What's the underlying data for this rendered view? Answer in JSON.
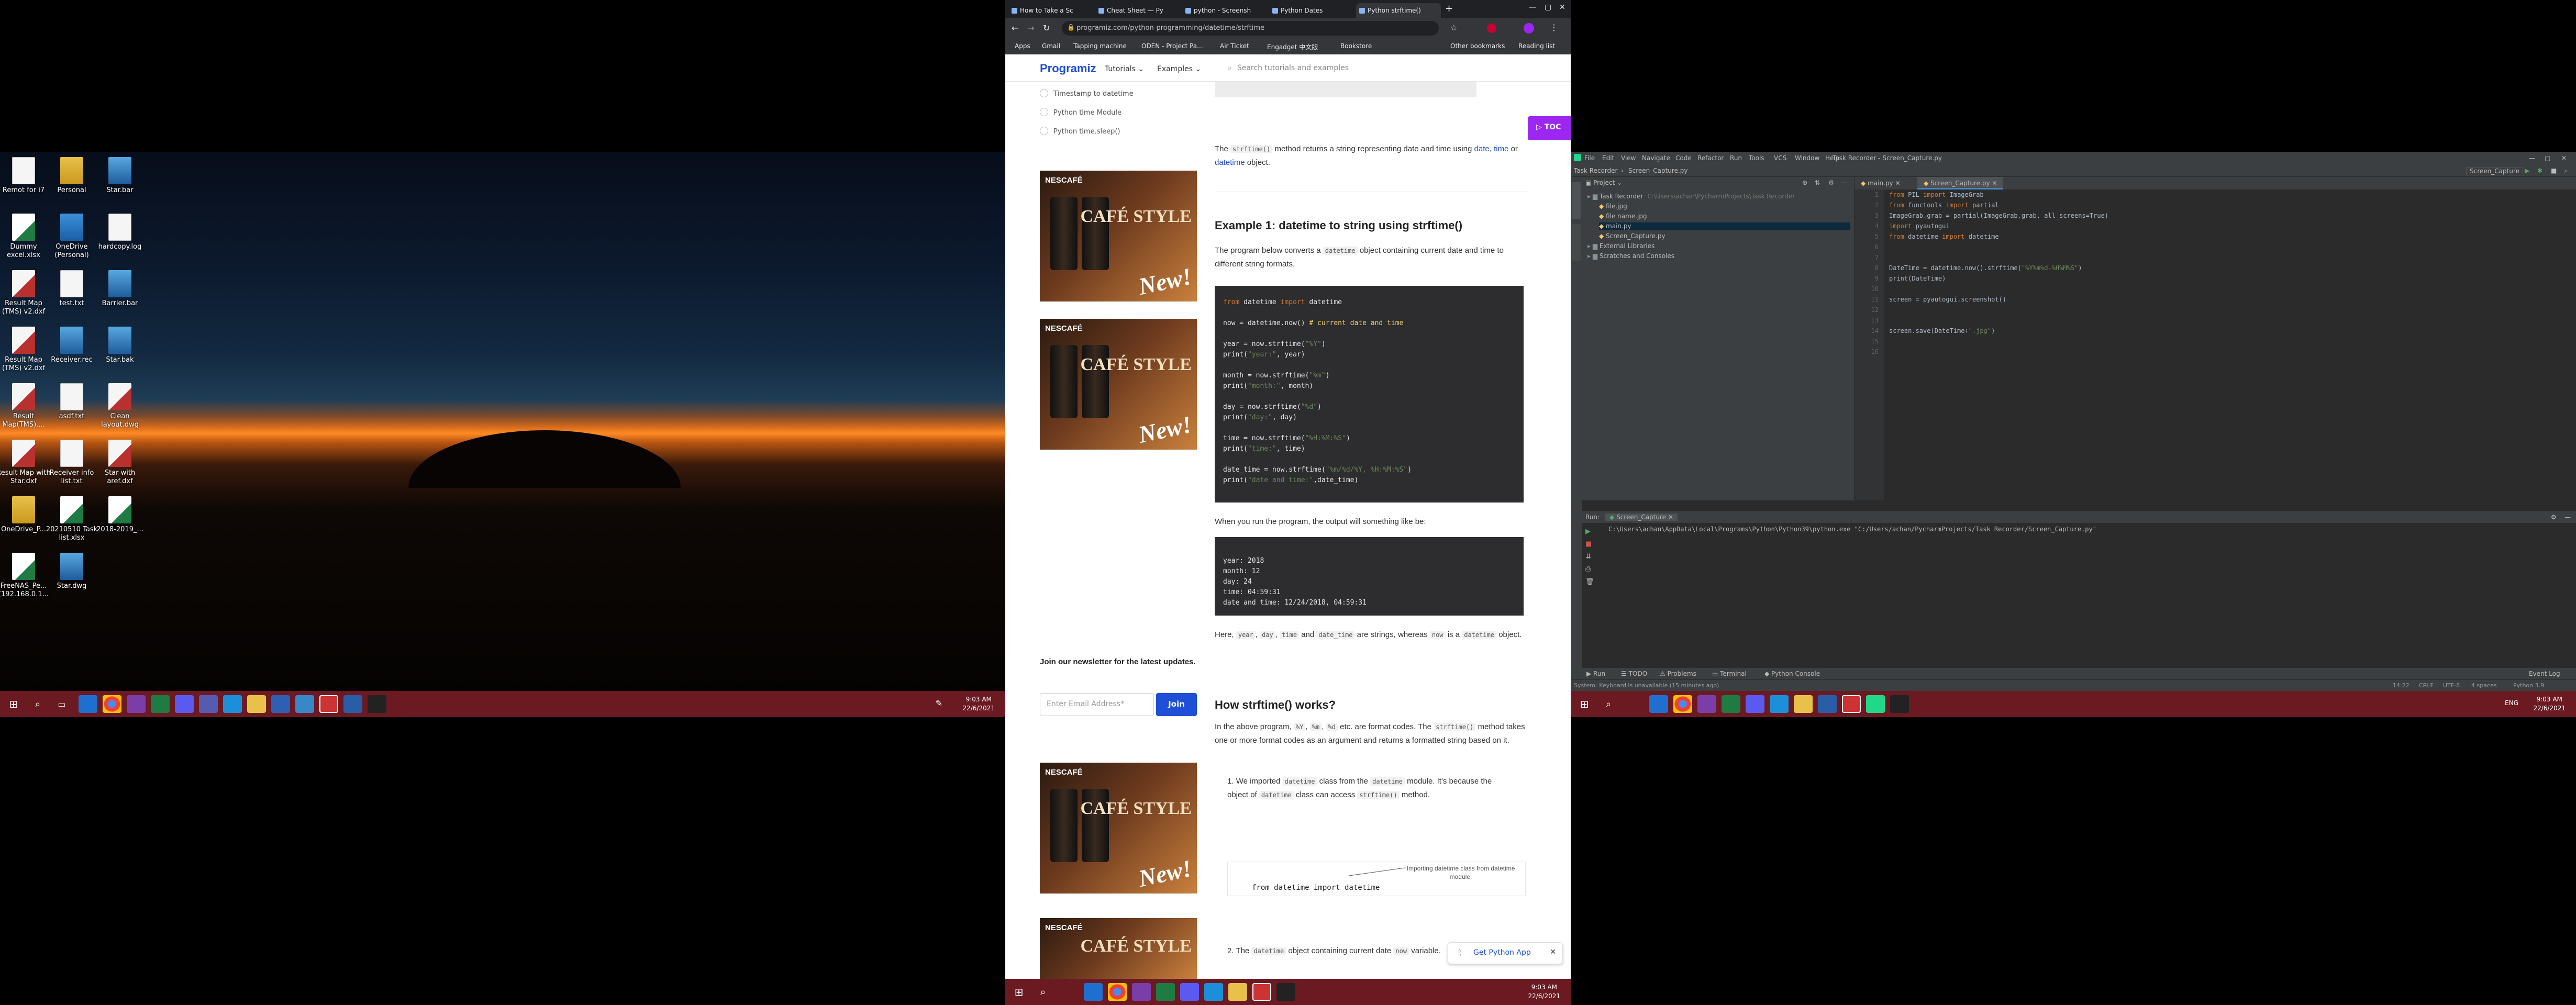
{
  "desktop": {
    "icons": [
      {
        "label": "Remot for i7",
        "kind": "file"
      },
      {
        "label": "Personal",
        "kind": "folder"
      },
      {
        "label": "Star.bar",
        "kind": "bar"
      },
      {
        "label": "Dummy excel.xlsx",
        "kind": "xl"
      },
      {
        "label": "OneDrive (Personal)",
        "kind": "od"
      },
      {
        "label": "hardcopy.log",
        "kind": "file"
      },
      {
        "label": "Result Map (TMS) v2.dxf",
        "kind": "dwg"
      },
      {
        "label": "test.txt",
        "kind": "file"
      },
      {
        "label": "Barrier.bar",
        "kind": "bar"
      },
      {
        "label": "Result Map (TMS) v2.dxf",
        "kind": "dwg"
      },
      {
        "label": "Receiver.rec",
        "kind": "bar"
      },
      {
        "label": "Star.bak",
        "kind": "bar"
      },
      {
        "label": "Result Map(TMS)....",
        "kind": "dwg"
      },
      {
        "label": "asdf.txt",
        "kind": "file"
      },
      {
        "label": "Clean layout.dwg",
        "kind": "dwg"
      },
      {
        "label": "Result Map with Star.dxf",
        "kind": "dwg"
      },
      {
        "label": "Receiver info list.txt",
        "kind": "file"
      },
      {
        "label": "Star with aref.dxf",
        "kind": "dwg"
      },
      {
        "label": "OneDrive_P...",
        "kind": "folder"
      },
      {
        "label": "20210510 Task list.xlsx",
        "kind": "xl"
      },
      {
        "label": "2018-2019_...",
        "kind": "xl"
      },
      {
        "label": "FreeNAS_Pe... (192.168.0.1...",
        "kind": "xl"
      },
      {
        "label": "Star.dwg",
        "kind": "bar"
      }
    ]
  },
  "taskbar": {
    "time": "9:03 AM",
    "date": "22/6/2021"
  },
  "browser": {
    "tabs": [
      "How to Take a Sc",
      "Cheat Sheet — Py",
      "python - Screensh",
      "Python Dates",
      "Python strftime()"
    ],
    "url": "programiz.com/python-programming/datetime/strftime",
    "bookmarks": [
      "Apps",
      "Gmail",
      "Tapping machine",
      "ODEN - Project Pa...",
      "Air Ticket",
      "Engadget 中文版",
      "Bookstore",
      "Other bookmarks",
      "Reading list"
    ],
    "site": {
      "logo": "Programiz",
      "nav": [
        "Tutorials",
        "Examples"
      ],
      "search_placeholder": "Search tutorials and examples",
      "sidebar_links": [
        "Timestamp to datetime",
        "Python time Module",
        "Python time.sleep()"
      ],
      "ad_brand": "NESCAFÉ",
      "ad_headline": "CAFÉ STYLE",
      "ad_tag": "New!",
      "toc": "TOC",
      "newsletter_title": "Join our newsletter for the latest updates.",
      "newsletter_placeholder": "Enter Email Address*",
      "newsletter_button": "Join",
      "get_app": "Get Python App"
    },
    "article": {
      "intro_a": "The",
      "intro_code": "strftime()",
      "intro_b": "method returns a string representing date and time using",
      "intro_link1": "date",
      "intro_link2": "time",
      "intro_or": "or",
      "intro_link3": "datetime",
      "intro_end": "object.",
      "ex1_title": "Example 1: datetime to string using strftime()",
      "ex1_desc_a": "The program below converts a",
      "ex1_desc_code": "datetime",
      "ex1_desc_b": "object containing current date and time to different string formats.",
      "code_lines": [
        "from datetime import datetime",
        "",
        "now = datetime.now() # current date and time",
        "",
        "year = now.strftime(\"%Y\")",
        "print(\"year:\", year)",
        "",
        "month = now.strftime(\"%m\")",
        "print(\"month:\", month)",
        "",
        "day = now.strftime(\"%d\")",
        "print(\"day:\", day)",
        "",
        "time = now.strftime(\"%H:%M:%S\")",
        "print(\"time:\", time)",
        "",
        "date_time = now.strftime(\"%m/%d/%Y, %H:%M:%S\")",
        "print(\"date and time:\",date_time)"
      ],
      "output_intro": "When you run the program, the output will something like be:",
      "output_lines": [
        "year: 2018",
        "month: 12",
        "day: 24",
        "time: 04:59:31",
        "date and time: 12/24/2018, 04:59:31"
      ],
      "here_a": "Here,",
      "here_codes": [
        "year",
        "day",
        "time",
        "date_time"
      ],
      "here_b": "are strings, whereas",
      "here_code2": "now",
      "here_c": "is a",
      "here_code3": "datetime",
      "here_d": "object.",
      "works_title": "How strftime() works?",
      "works_a": "In the above program,",
      "works_codes": [
        "%Y",
        "%m",
        "%d"
      ],
      "works_b": "etc. are format codes. The",
      "works_code2": "strftime()",
      "works_c": "method takes one or more format codes as an argument and returns a formatted string based on it.",
      "step1_a": "We imported",
      "step1_code": "datetime",
      "step1_b": "class from the",
      "step1_code2": "datetime",
      "step1_c": "module. It's because the object of",
      "step1_code3": "datetime",
      "step1_d": "class can access",
      "step1_code4": "strftime()",
      "step1_e": "method.",
      "diagram_code": "from datetime import datetime",
      "diagram_note": "Importing datetime class from datetime module.",
      "step2_a": "The",
      "step2_code": "datetime",
      "step2_b": "object containing current date",
      "step2_code2": "now",
      "step2_c": "variable."
    }
  },
  "ide": {
    "menu": [
      "File",
      "Edit",
      "View",
      "Navigate",
      "Code",
      "Refactor",
      "Run",
      "Tools",
      "VCS",
      "Window",
      "Help"
    ],
    "window_title": "Task Recorder - Screen_Capture.py",
    "breadcrumb": [
      "Task Recorder",
      "Screen_Capture.py"
    ],
    "run_config": "Screen_Capture",
    "project_label": "Project",
    "tree": [
      {
        "label": "Task Recorder",
        "detail": "C:\\Users\\achan\\PycharmProjects\\Task Recorder",
        "depth": 0
      },
      {
        "label": "file.jpg",
        "detail": "",
        "depth": 1
      },
      {
        "label": "file name.jpg",
        "detail": "",
        "depth": 1
      },
      {
        "label": "main.py",
        "detail": "",
        "depth": 1
      },
      {
        "label": "Screen_Capture.py",
        "detail": "",
        "depth": 1
      },
      {
        "label": "External Libraries",
        "detail": "",
        "depth": 0
      },
      {
        "label": "Scratches and Consoles",
        "detail": "",
        "depth": 0
      }
    ],
    "editor_tabs": [
      "main.py",
      "Screen_Capture.py"
    ],
    "code": [
      "from PIL import ImageGrab",
      "from functools import partial",
      "ImageGrab.grab = partial(ImageGrab.grab, all_screens=True)",
      "import pyautogui",
      "from datetime import datetime",
      "",
      "",
      "DateTime = datetime.now().strftime(\"%Y%m%d-%H%M%S\")",
      "print(DateTime)",
      "",
      "screen = pyautogui.screenshot()",
      "",
      "",
      "screen.save(DateTime+\".jpg\")",
      "",
      ""
    ],
    "run_tab": "Run:",
    "run_name": "Screen_Capture",
    "run_output": "C:\\Users\\achan\\AppData\\Local\\Programs\\Python\\Python39\\python.exe \"C:/Users/achan/PycharmProjects/Task Recorder/Screen_Capture.py\"",
    "bottom_tabs": [
      "Run",
      "TODO",
      "Problems",
      "Terminal",
      "Python Console"
    ],
    "event_log": "Event Log",
    "status_left": "System: Keyboard is unavailable (15 minutes ago)",
    "status_right": [
      "14:22",
      "CRLF",
      "UTF-8",
      "4 spaces",
      "Python 3.9"
    ]
  }
}
